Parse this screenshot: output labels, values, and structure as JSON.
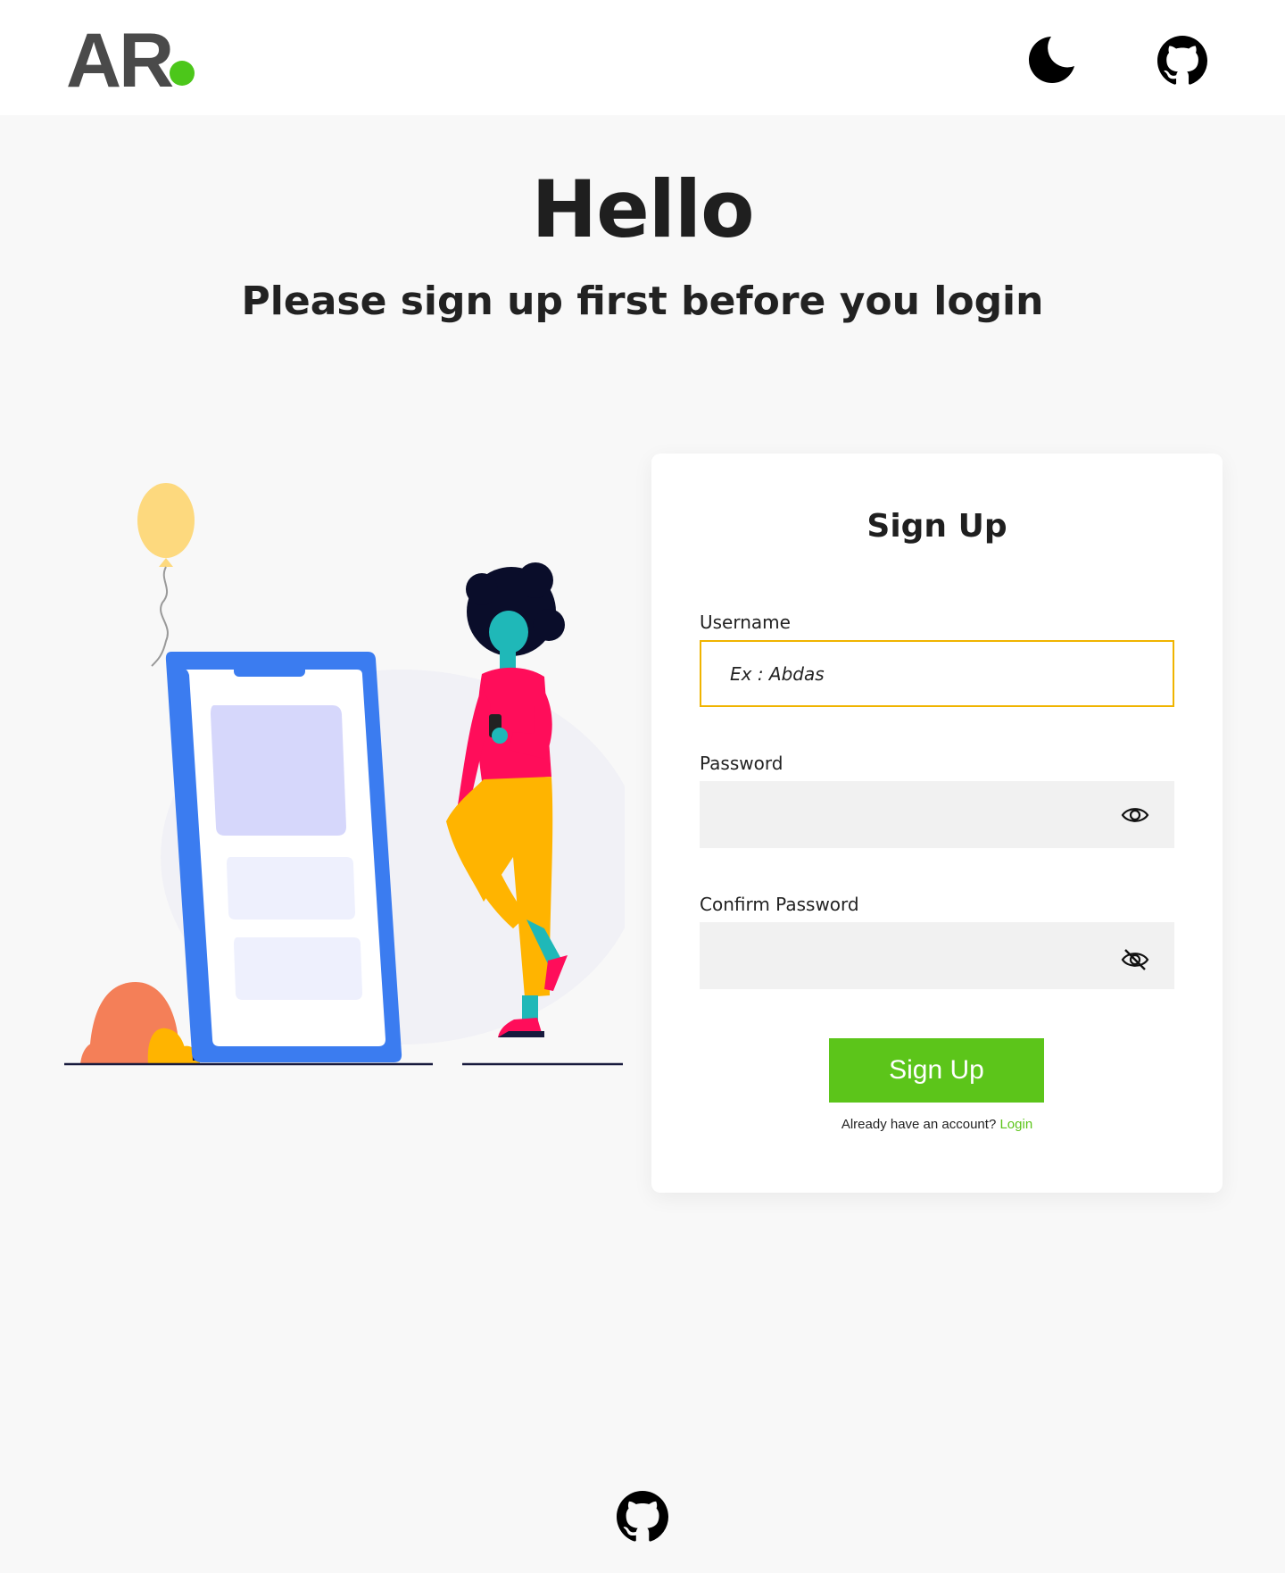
{
  "header": {
    "logo_text": "AR",
    "logo_dot_color": "#4cc71a",
    "theme_toggle_icon": "moon-icon",
    "github_icon": "github-icon"
  },
  "hero": {
    "title": "Hello",
    "subtitle": "Please sign up first before you login"
  },
  "illustration": {
    "description_icon": "phone-woman-illustration"
  },
  "signup_form": {
    "title": "Sign Up",
    "username_label": "Username",
    "username_placeholder": "Ex : Abdas",
    "username_value": "",
    "password_label": "Password",
    "password_value": "",
    "password_toggle_icon": "eye-icon",
    "confirm_label": "Confirm Password",
    "confirm_value": "",
    "confirm_toggle_icon": "eye-off-icon",
    "submit_label": "Sign Up",
    "already_text": "Already have an account?",
    "login_link": "Login"
  },
  "footer": {
    "github_icon": "github-icon"
  },
  "colors": {
    "accent_green": "#5cc51a",
    "focus_border": "#f0b400",
    "background": "#f8f8f8"
  }
}
